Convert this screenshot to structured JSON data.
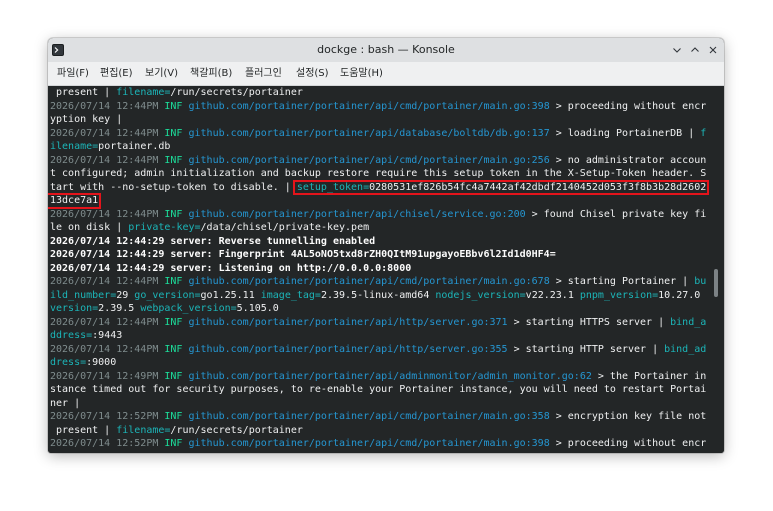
{
  "window": {
    "title": "dockge : bash — Konsole",
    "app_icon": "terminal-icon",
    "controls": {
      "minimize_icon": "chevron-down-icon",
      "maximize_icon": "chevron-up-icon",
      "close_icon": "close-icon"
    },
    "titlebar_color": "#dee0e2",
    "menubar_color": "#eff0f1"
  },
  "menu": {
    "items": [
      "파일(F)",
      "편집(E)",
      "보기(V)",
      "책갈피(B)",
      "플러그인",
      "설정(S)",
      "도움말(H)"
    ]
  },
  "scrollbar": {
    "scroll_position_percent": 54
  },
  "terminal": {
    "background": "#232627",
    "highlight_box_color": "#e4141b",
    "lines": [
      [
        {
          "t": " present | ",
          "fg": "#eff0f1"
        },
        {
          "t": "filename=",
          "fg": "#1cb5b8"
        },
        {
          "t": "/run/secrets/portainer",
          "fg": "#eff0f1"
        }
      ],
      [
        {
          "t": "2026/07/14 12:44PM ",
          "fg": "#7f8c8d"
        },
        {
          "t": "INF ",
          "fg": "#1cdc9a"
        },
        {
          "t": "github.com/portainer/portainer/api/cmd/portainer/main.go:398",
          "fg": "#2596d1"
        },
        {
          "t": " > proceeding without encr",
          "fg": "#eff0f1"
        }
      ],
      [
        {
          "t": "yption key |",
          "fg": "#eff0f1"
        }
      ],
      [
        {
          "t": "2026/07/14 12:44PM ",
          "fg": "#7f8c8d"
        },
        {
          "t": "INF ",
          "fg": "#1cdc9a"
        },
        {
          "t": "github.com/portainer/portainer/api/database/boltdb/db.go:137",
          "fg": "#2596d1"
        },
        {
          "t": " > loading PortainerDB | ",
          "fg": "#eff0f1"
        },
        {
          "t": "f",
          "fg": "#1cb5b8"
        }
      ],
      [
        {
          "t": "ilename=",
          "fg": "#1cb5b8"
        },
        {
          "t": "portainer.db",
          "fg": "#eff0f1"
        }
      ],
      [
        {
          "t": "2026/07/14 12:44PM ",
          "fg": "#7f8c8d"
        },
        {
          "t": "INF ",
          "fg": "#1cdc9a"
        },
        {
          "t": "github.com/portainer/portainer/api/cmd/portainer/main.go:256",
          "fg": "#2596d1"
        },
        {
          "t": " > no administrator accoun",
          "fg": "#eff0f1"
        }
      ],
      [
        {
          "t": "t configured; admin initialization and backup restore require this setup token in the X-Setup-Token header. S",
          "fg": "#eff0f1"
        }
      ],
      [
        {
          "t": "tart with --no-setup-token to disable. | ",
          "fg": "#eff0f1"
        },
        {
          "highlight": [
            {
              "t": "setup_token=",
              "fg": "#1cb5b8"
            },
            {
              "t": "0280531ef826b54fc4a7442af42dbdf2140452d053f3f8b3b28d2602",
              "fg": "#eff0f1"
            }
          ]
        }
      ],
      [
        {
          "highlight": [
            {
              "t": "13dce7a1",
              "fg": "#eff0f1"
            }
          ]
        }
      ],
      [
        {
          "t": "2026/07/14 12:44PM ",
          "fg": "#7f8c8d"
        },
        {
          "t": "INF ",
          "fg": "#1cdc9a"
        },
        {
          "t": "github.com/portainer/portainer/api/chisel/service.go:200",
          "fg": "#2596d1"
        },
        {
          "t": " > found Chisel private key fi",
          "fg": "#eff0f1"
        }
      ],
      [
        {
          "t": "le on disk | ",
          "fg": "#eff0f1"
        },
        {
          "t": "private-key=",
          "fg": "#1cb5b8"
        },
        {
          "t": "/data/chisel/private-key.pem",
          "fg": "#eff0f1"
        }
      ],
      [
        {
          "t": "2026/07/14 12:44:29 server: Reverse tunnelling enabled",
          "fg": "#fcfcfc",
          "bold": true
        }
      ],
      [
        {
          "t": "2026/07/14 12:44:29 server: Fingerprint 4AL5oNO5txd8rZH0QItM91upgayoEBbv6l2Id1d0HF4=",
          "fg": "#fcfcfc",
          "bold": true
        }
      ],
      [
        {
          "t": "2026/07/14 12:44:29 server: Listening on http://0.0.0.0:8000",
          "fg": "#fcfcfc",
          "bold": true
        }
      ],
      [
        {
          "t": "2026/07/14 12:44PM ",
          "fg": "#7f8c8d"
        },
        {
          "t": "INF ",
          "fg": "#1cdc9a"
        },
        {
          "t": "github.com/portainer/portainer/api/cmd/portainer/main.go:678",
          "fg": "#2596d1"
        },
        {
          "t": " > starting Portainer | ",
          "fg": "#eff0f1"
        },
        {
          "t": "bu",
          "fg": "#1cb5b8"
        }
      ],
      [
        {
          "t": "ild_number=",
          "fg": "#1cb5b8"
        },
        {
          "t": "29 ",
          "fg": "#eff0f1"
        },
        {
          "t": "go_version=",
          "fg": "#1cb5b8"
        },
        {
          "t": "go1.25.11 ",
          "fg": "#eff0f1"
        },
        {
          "t": "image_tag=",
          "fg": "#1cb5b8"
        },
        {
          "t": "2.39.5-linux-amd64 ",
          "fg": "#eff0f1"
        },
        {
          "t": "nodejs_version=",
          "fg": "#1cb5b8"
        },
        {
          "t": "v22.23.1 ",
          "fg": "#eff0f1"
        },
        {
          "t": "pnpm_version=",
          "fg": "#1cb5b8"
        },
        {
          "t": "10.27.0 ",
          "fg": "#eff0f1"
        }
      ],
      [
        {
          "t": "version=",
          "fg": "#1cb5b8"
        },
        {
          "t": "2.39.5 ",
          "fg": "#eff0f1"
        },
        {
          "t": "webpack_version=",
          "fg": "#1cb5b8"
        },
        {
          "t": "5.105.0",
          "fg": "#eff0f1"
        }
      ],
      [
        {
          "t": "2026/07/14 12:44PM ",
          "fg": "#7f8c8d"
        },
        {
          "t": "INF ",
          "fg": "#1cdc9a"
        },
        {
          "t": "github.com/portainer/portainer/api/http/server.go:371",
          "fg": "#2596d1"
        },
        {
          "t": " > starting HTTPS server | ",
          "fg": "#eff0f1"
        },
        {
          "t": "bind_a",
          "fg": "#1cb5b8"
        }
      ],
      [
        {
          "t": "ddress=",
          "fg": "#1cb5b8"
        },
        {
          "t": ":9443",
          "fg": "#eff0f1"
        }
      ],
      [
        {
          "t": "2026/07/14 12:44PM ",
          "fg": "#7f8c8d"
        },
        {
          "t": "INF ",
          "fg": "#1cdc9a"
        },
        {
          "t": "github.com/portainer/portainer/api/http/server.go:355",
          "fg": "#2596d1"
        },
        {
          "t": " > starting HTTP server | ",
          "fg": "#eff0f1"
        },
        {
          "t": "bind_ad",
          "fg": "#1cb5b8"
        }
      ],
      [
        {
          "t": "dress=",
          "fg": "#1cb5b8"
        },
        {
          "t": ":9000",
          "fg": "#eff0f1"
        }
      ],
      [
        {
          "t": "2026/07/14 12:49PM ",
          "fg": "#7f8c8d"
        },
        {
          "t": "INF ",
          "fg": "#1cdc9a"
        },
        {
          "t": "github.com/portainer/portainer/api/adminmonitor/admin_monitor.go:62",
          "fg": "#2596d1"
        },
        {
          "t": " > the Portainer in",
          "fg": "#eff0f1"
        }
      ],
      [
        {
          "t": "stance timed out for security purposes, to re-enable your Portainer instance, you will need to restart Portai",
          "fg": "#eff0f1"
        }
      ],
      [
        {
          "t": "ner |",
          "fg": "#eff0f1"
        }
      ],
      [
        {
          "t": "2026/07/14 12:52PM ",
          "fg": "#7f8c8d"
        },
        {
          "t": "INF ",
          "fg": "#1cdc9a"
        },
        {
          "t": "github.com/portainer/portainer/api/cmd/portainer/main.go:358",
          "fg": "#2596d1"
        },
        {
          "t": " > encryption key file not",
          "fg": "#eff0f1"
        }
      ],
      [
        {
          "t": " present | ",
          "fg": "#eff0f1"
        },
        {
          "t": "filename=",
          "fg": "#1cb5b8"
        },
        {
          "t": "/run/secrets/portainer",
          "fg": "#eff0f1"
        }
      ],
      [
        {
          "t": "2026/07/14 12:52PM ",
          "fg": "#7f8c8d"
        },
        {
          "t": "INF ",
          "fg": "#1cdc9a"
        },
        {
          "t": "github.com/portainer/portainer/api/cmd/portainer/main.go:398",
          "fg": "#2596d1"
        },
        {
          "t": " > proceeding without encr",
          "fg": "#eff0f1"
        }
      ]
    ]
  }
}
